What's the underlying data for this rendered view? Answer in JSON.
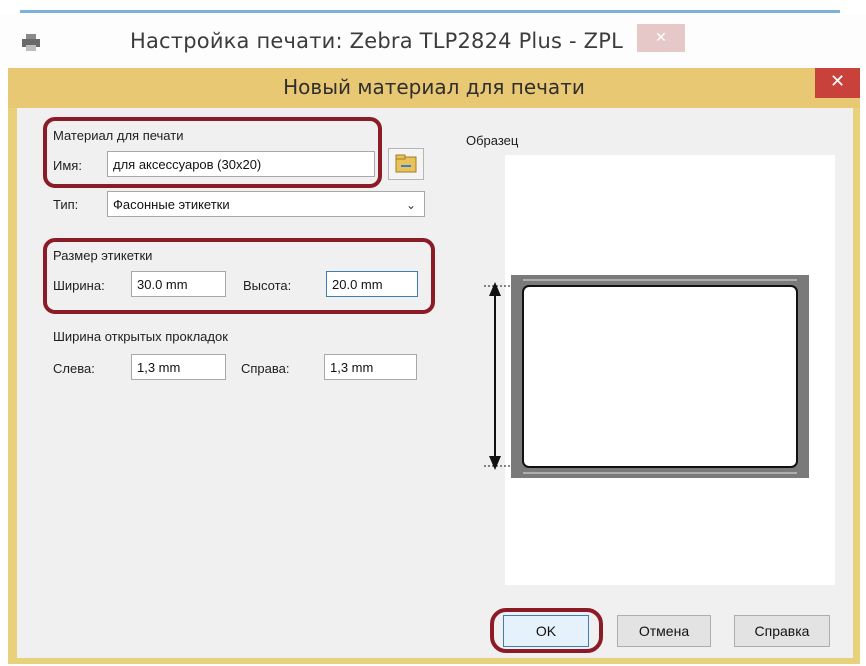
{
  "outer_window": {
    "title": "Настройка печати: Zebra TLP2824 Plus - ZPL",
    "close_glyph": "✕"
  },
  "dialog": {
    "title": "Новый материал для печати",
    "close_glyph": "✕",
    "accent_color": "#e8c872",
    "close_color": "#c8413b"
  },
  "media_group": {
    "label": "Материал для печати",
    "name_label": "Имя:",
    "name_value": "для аксессуаров (30x20)",
    "type_label": "Тип:",
    "type_value": "Фасонные этикетки",
    "type_chevron": "⌄"
  },
  "size_group": {
    "label": "Размер этикетки",
    "width_label": "Ширина:",
    "width_value": "30.0 mm",
    "height_label": "Высота:",
    "height_value": "20.0 mm"
  },
  "liner_group": {
    "label": "Ширина открытых прокладок",
    "left_label": "Слева:",
    "left_value": "1,3 mm",
    "right_label": "Справа:",
    "right_value": "1,3 mm"
  },
  "preview": {
    "label": "Образец"
  },
  "buttons": {
    "ok": "OK",
    "cancel": "Отмена",
    "help": "Справка"
  },
  "annotation_color": "#8b1c27"
}
